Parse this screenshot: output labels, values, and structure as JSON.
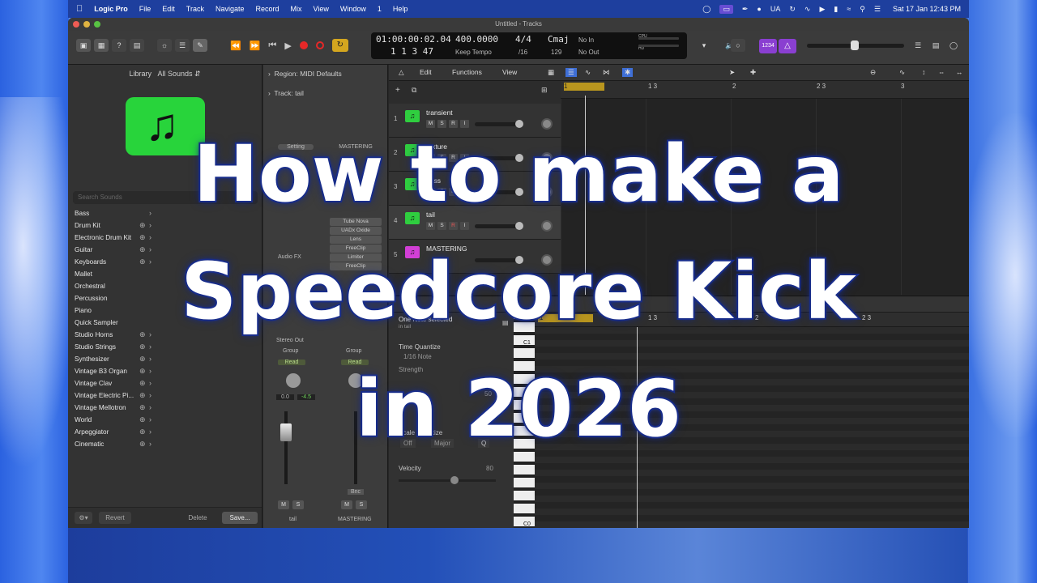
{
  "menubar": {
    "app_name": "Logic Pro",
    "items": [
      "File",
      "Edit",
      "Track",
      "Navigate",
      "Record",
      "Mix",
      "View",
      "Window",
      "1",
      "Help"
    ],
    "status_ua": "UA",
    "date_time": "Sat 17 Jan  12:43 PM"
  },
  "window": {
    "title": "Untitled - Tracks"
  },
  "lcd": {
    "time": "01:00:00:02.04",
    "bars": "1  1  3    47",
    "tempo": "400.0000",
    "tempo_mode": "Keep Tempo",
    "sig_top": "4/4",
    "sig_bottom": "/16",
    "key": "Cmaj",
    "key_num": "129",
    "in": "No In",
    "out": "No Out",
    "cpu_label": "CPU",
    "hd_label": "HD"
  },
  "toolbar": {
    "count_in": "1234"
  },
  "library": {
    "title": "Library",
    "filter": "All Sounds",
    "search_placeholder": "Search Sounds",
    "items": [
      "Bass",
      "Drum Kit",
      "Electronic Drum Kit",
      "Guitar",
      "Keyboards",
      "Mallet",
      "Orchestral",
      "Percussion",
      "Piano",
      "Quick Sampler",
      "Studio Horns",
      "Studio Strings",
      "Synthesizer",
      "Vintage B3 Organ",
      "Vintage Clav",
      "Vintage Electric Pi...",
      "Vintage Mellotron",
      "World",
      "Arpeggiator",
      "Cinematic"
    ],
    "revert": "Revert",
    "delete": "Delete",
    "save": "Save..."
  },
  "inspector": {
    "region": "Region: MIDI Defaults",
    "track": "Track:  tail",
    "setting": "Setting",
    "mastering": "MASTERING",
    "audio_fx": "Audio FX",
    "plugins": [
      "Tube Nova",
      "UADx Oxide",
      "Lens",
      "FreeClip",
      "Limiter",
      "FreeClip"
    ],
    "stereo_out": "Stereo Out",
    "group": "Group",
    "read": "Read",
    "val_left": "0.0",
    "val_right": "-4.5",
    "bnc": "Bnc",
    "strip_left": "tail",
    "strip_right": "MASTERING"
  },
  "tracks_bar": {
    "edit": "Edit",
    "functions": "Functions",
    "view": "View"
  },
  "tracks": [
    {
      "num": "1",
      "name": "transient",
      "color": "#2fce3f"
    },
    {
      "num": "2",
      "name": "texture",
      "color": "#2fce3f"
    },
    {
      "num": "3",
      "name": "bass",
      "color": "#2fce3f"
    },
    {
      "num": "4",
      "name": "tail",
      "color": "#2fce3f"
    },
    {
      "num": "5",
      "name": "MASTERING",
      "color": "#d23fd6"
    }
  ],
  "ruler": [
    "1",
    "1 3",
    "2",
    "2 3",
    "3"
  ],
  "editor": {
    "selection": "One Note selected",
    "selection_sub": "in tail",
    "time_quantize": "Time Quantize",
    "quantize_value": "1/16 Note",
    "strength": "Strength",
    "swing_value": "50",
    "scale_quantize": "Scale Quantize",
    "scale_off": "Off",
    "scale_major": "Major",
    "velocity": "Velocity",
    "velocity_value": "80",
    "key_c1": "C1",
    "key_c0": "C0",
    "ruler": [
      "1",
      "1 3",
      "2",
      "2 3"
    ]
  },
  "overlay": {
    "line1": "How to make a",
    "line2": "Speedcore Kick",
    "line3": "in 2026"
  }
}
